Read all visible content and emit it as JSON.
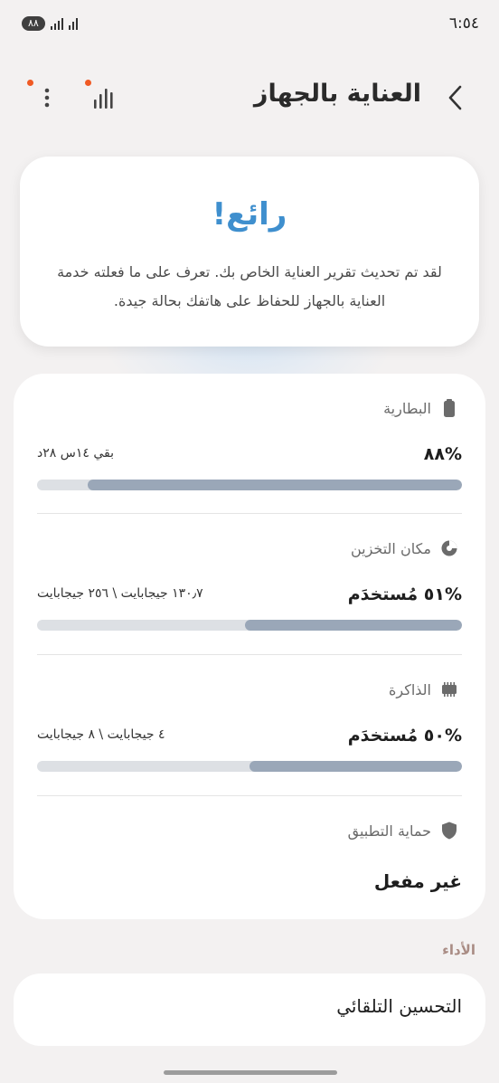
{
  "status_bar": {
    "time": "٦:٥٤",
    "battery": "٨٨"
  },
  "header": {
    "title": "العناية بالجهاز"
  },
  "hero": {
    "title": "رائع!",
    "message": "لقد تم تحديث تقرير العناية الخاص بك. تعرف على ما فعلته خدمة العناية بالجهاز للحفاظ على هاتفك بحالة جيدة."
  },
  "battery": {
    "label": "البطارية",
    "value": "%٨٨",
    "remaining": "بقي ١٤س ٢٨د",
    "level": 0.88
  },
  "storage": {
    "label": "مكان التخزين",
    "value": "%٥١ مُستخدَم",
    "detail": "١٣٠٫٧ جيجابايت \\ ٢٥٦ جيجابايت",
    "level": 0.51
  },
  "memory": {
    "label": "الذاكرة",
    "value": "%٥٠ مُستخدَم",
    "detail": "٤ جيجابايت \\ ٨ جيجابايت",
    "level": 0.5
  },
  "app_protection": {
    "label": "حماية التطبيق",
    "value": "غير مفعل"
  },
  "performance": {
    "section_label": "الأداء",
    "auto_optimize": "التحسين التلقائي"
  },
  "colors": {
    "accent_blue": "#3f8fce",
    "bar_fill": "#9aa7b8",
    "bar_track": "#dde0e4",
    "badge_orange": "#f05a24"
  }
}
